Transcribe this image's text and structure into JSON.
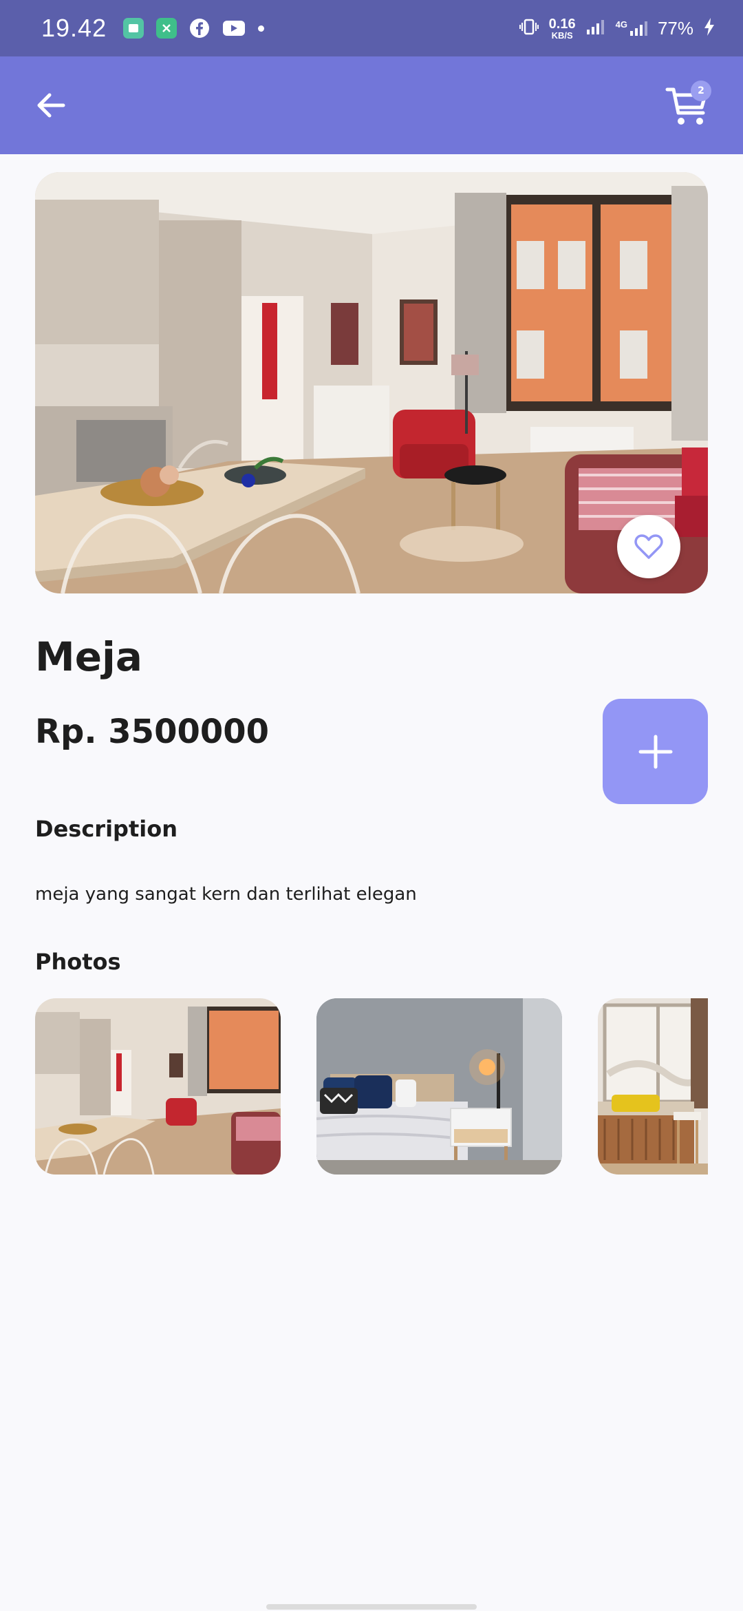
{
  "status_bar": {
    "time": "19.42",
    "net_speed_value": "0.16",
    "net_speed_unit": "KB/S",
    "network_type": "4G",
    "battery": "77%",
    "icons": [
      "app-notification-icon",
      "app-notification-icon",
      "facebook-icon",
      "youtube-icon",
      "vibrate-icon",
      "signal-icon",
      "charging-icon"
    ]
  },
  "app_bar": {
    "back_icon": "arrow-left-icon",
    "cart_icon": "cart-icon",
    "cart_count": "2",
    "color": "#7276d9"
  },
  "product": {
    "name": "Meja",
    "price": "Rp. 3500000",
    "favorite_icon": "heart-outline-icon",
    "add_icon": "plus-icon"
  },
  "description": {
    "title": "Description",
    "text": "meja yang sangat kern dan terlihat elegan"
  },
  "photos": {
    "title": "Photos",
    "items": [
      "living-room-photo",
      "bedroom-photo",
      "window-nook-photo"
    ]
  },
  "colors": {
    "status_bar": "#5b5fab",
    "app_bar": "#7276d9",
    "accent_button": "#9396f5",
    "background": "#f9f9fc"
  }
}
